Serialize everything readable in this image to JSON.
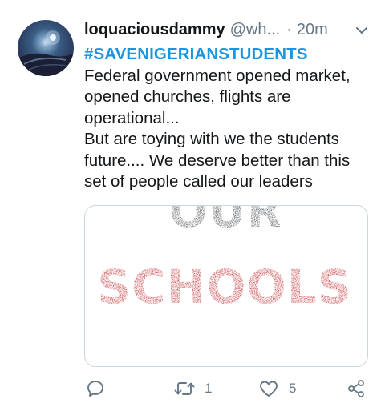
{
  "tweet": {
    "display_name": "loquaciousdammy",
    "handle": "@wh...",
    "separator": "·",
    "time": "20m",
    "hashtag": "#SAVENIGERIANSTUDENTS",
    "lines": [
      "Federal government opened market,",
      "opened churches, flights are",
      "operational...",
      "But are toying with we the students",
      "future.... We deserve better than this",
      "set of people called our leaders"
    ],
    "image": {
      "word1": "OUR",
      "word2": "SCHOOLS",
      "color1": "#3d4146",
      "color2": "#c1272d"
    },
    "actions": {
      "retweets": "1",
      "likes": "5"
    },
    "colors": {
      "hashtag": "#1b95e0",
      "secondary_text": "#657786",
      "primary_text": "#14171a"
    },
    "icons": {
      "reply": "speech-bubble-icon",
      "retweet": "retweet-arrows-icon",
      "like": "heart-icon",
      "share": "share-nodes-icon",
      "menu": "chevron-down-icon"
    }
  }
}
